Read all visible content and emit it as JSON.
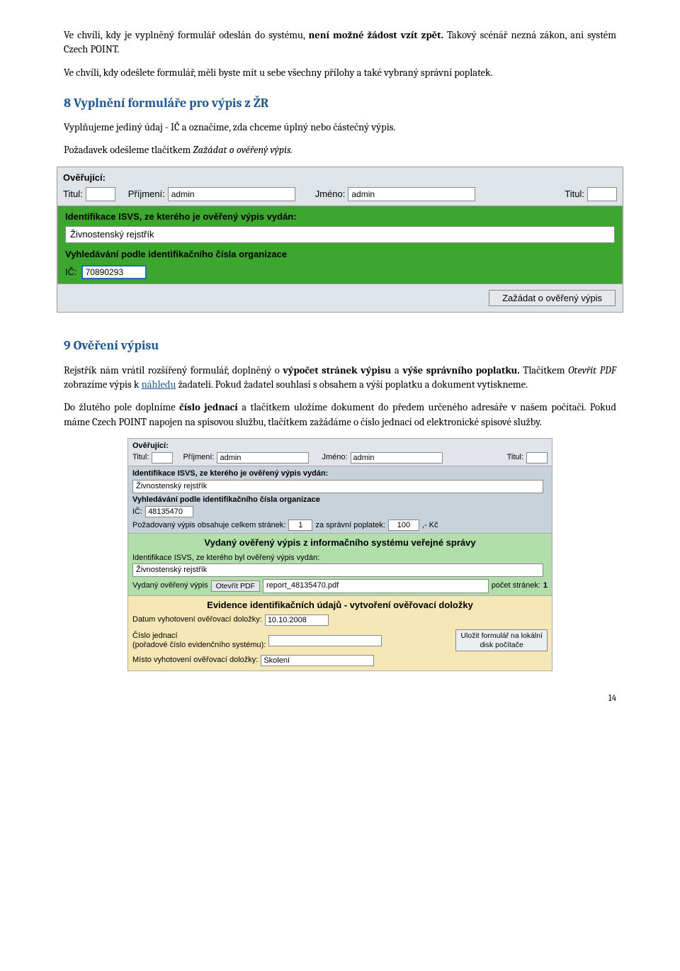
{
  "p1_a": "Ve chvíli, kdy je vyplněný formulář odeslán do systému, ",
  "p1_b": "není možné žádost vzít zpět.",
  "p1_c": " Takový scénář nezná zákon, ani systém Czech POINT.",
  "p2": "Ve chvíli, kdy odešlete formulář, měli byste mít u sebe všechny přílohy a také vybraný správní poplatek.",
  "h8": "8   Vyplnění formuláře pro výpis z ŽR",
  "p3": "Vyplňujeme jediný údaj - IČ a označíme, zda chceme úplný nebo částečný výpis.",
  "p4_a": "Požadavek odešleme tlačítkem ",
  "p4_b": "Zažádat o ověřený výpis.",
  "f1": {
    "overujici": "Ověřující:",
    "titul": "Titul:",
    "prijmeni": "Příjmení:",
    "jmeno": "Jméno:",
    "admin": "admin",
    "ident": "Identifikace ISVS, ze kterého je ověřený výpis vydán:",
    "zr": "Živnostenský rejstřík",
    "vyhled": "Vyhledávání podle identifikačního čísla organizace",
    "ic": "IČ:",
    "icval": "70890293",
    "btn": "Zažádat o ověřený výpis"
  },
  "h9": "9   Ověření výpisu",
  "p5_a": "Rejstřík nám vrátil rozšířený formulář, doplněný o ",
  "p5_b": "výpočet stránek výpisu",
  "p5_c": " a ",
  "p5_d": "výše správního poplatku.",
  "p5_e": " Tlačítkem ",
  "p5_f": "Otevřít PDF",
  "p5_g": " zobrazíme výpis k ",
  "p5_h": "náhledu",
  "p5_i": " žadateli. Pokud žadatel souhlasí s obsahem a výší poplatku a dokument vytiskneme.",
  "p6_a": "Do žlutého pole doplníme ",
  "p6_b": "číslo jednací",
  "p6_c": " a tlačítkem uložíme dokument do předem určeného adresáře v našem počítači. Pokud máme Czech POINT napojen na spisovou službu, tlačítkem zažádáme o číslo jednací od elektronické spisové služby.",
  "f2": {
    "overujici": "Ověřující:",
    "titul": "Titul:",
    "prijmeni": "Příjmení:",
    "jmeno": "Jméno:",
    "admin": "admin",
    "ident": "Identifikace ISVS, ze kterého je ověřený výpis vydán:",
    "zr": "Živnostenský rejstřík",
    "vyhled": "Vyhledávání podle identifikačního čísla organizace",
    "ic": "IČ:",
    "icval": "48135470",
    "pozad_a": "Požadovaný výpis obsahuje celkem stránek:",
    "pozad_b": "za správní poplatek:",
    "pozad_c": ",- Kč",
    "pages": "1",
    "fee": "100",
    "title_green": "Vydaný ověřený výpis z informačního systému veřejné správy",
    "ident2": "Identifikace ISVS, ze kterého byl ověřený výpis vydán:",
    "vydany": "Vydaný ověřený výpis",
    "openpdf": "Otevřít PDF",
    "pdfname": "report_48135470.pdf",
    "pocet": "počet stránek:",
    "pocetval": "1",
    "title_yellow": "Evidence identifikačních údajů - vytvoření ověřovací doložky",
    "datum": "Datum vyhotovení ověřovací doložky:",
    "datumval": "10.10.2008",
    "cislo_a": "Číslo jednací",
    "cislo_b": "(pořadové číslo evidenčního systému):",
    "save_a": "Uložit formulář na lokální",
    "save_b": "disk počítače",
    "misto": "Místo vyhotovení ověřovací doložky:",
    "mistoval": "Školení"
  },
  "pagenum": "14"
}
